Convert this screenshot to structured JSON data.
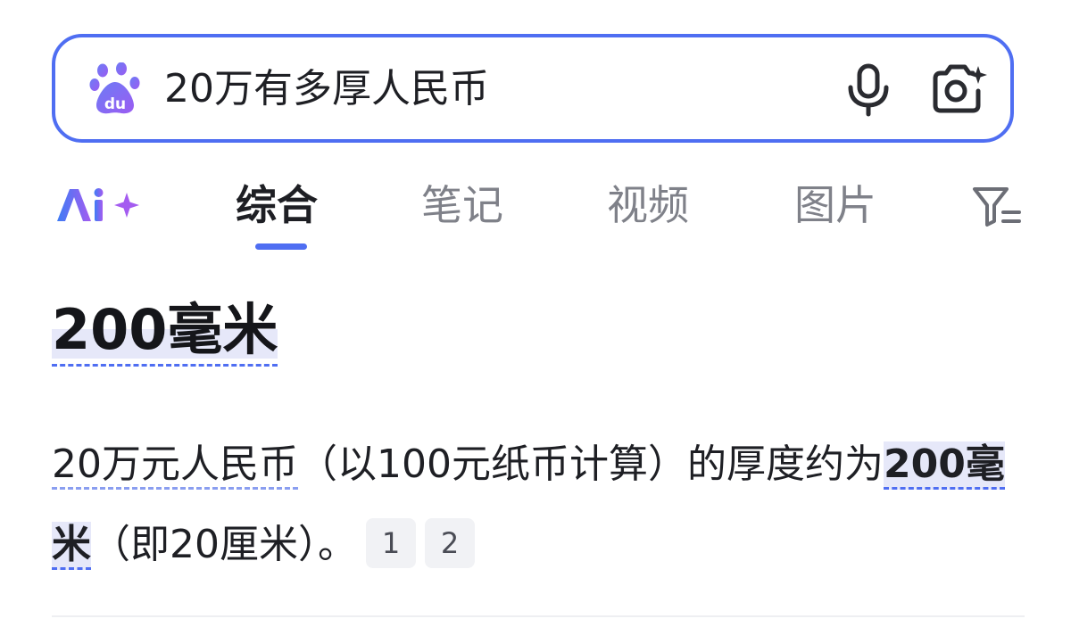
{
  "search": {
    "query": "20万有多厚人民币",
    "logo_icon": "baidu-paw-du-logo",
    "mic_icon": "microphone-icon",
    "camera_icon": "camera-sparkle-icon"
  },
  "tabs": {
    "ai_icon": "ai-sparkle-icon",
    "items": [
      {
        "label": "综合",
        "active": true
      },
      {
        "label": "笔记",
        "active": false
      },
      {
        "label": "视频",
        "active": false
      },
      {
        "label": "图片",
        "active": false
      }
    ],
    "filter_icon": "filter-icon"
  },
  "answer": {
    "title": "200毫米",
    "body_part1": "20万元人民币",
    "body_part2": "（以100元纸币计算）的厚度约为",
    "body_highlight": "200毫米",
    "body_part3": "（即20厘米）。",
    "refs": [
      "1",
      "2"
    ]
  },
  "colors": {
    "accent": "#4f6ef2",
    "text": "#1e1f24",
    "muted": "#7f8189"
  }
}
